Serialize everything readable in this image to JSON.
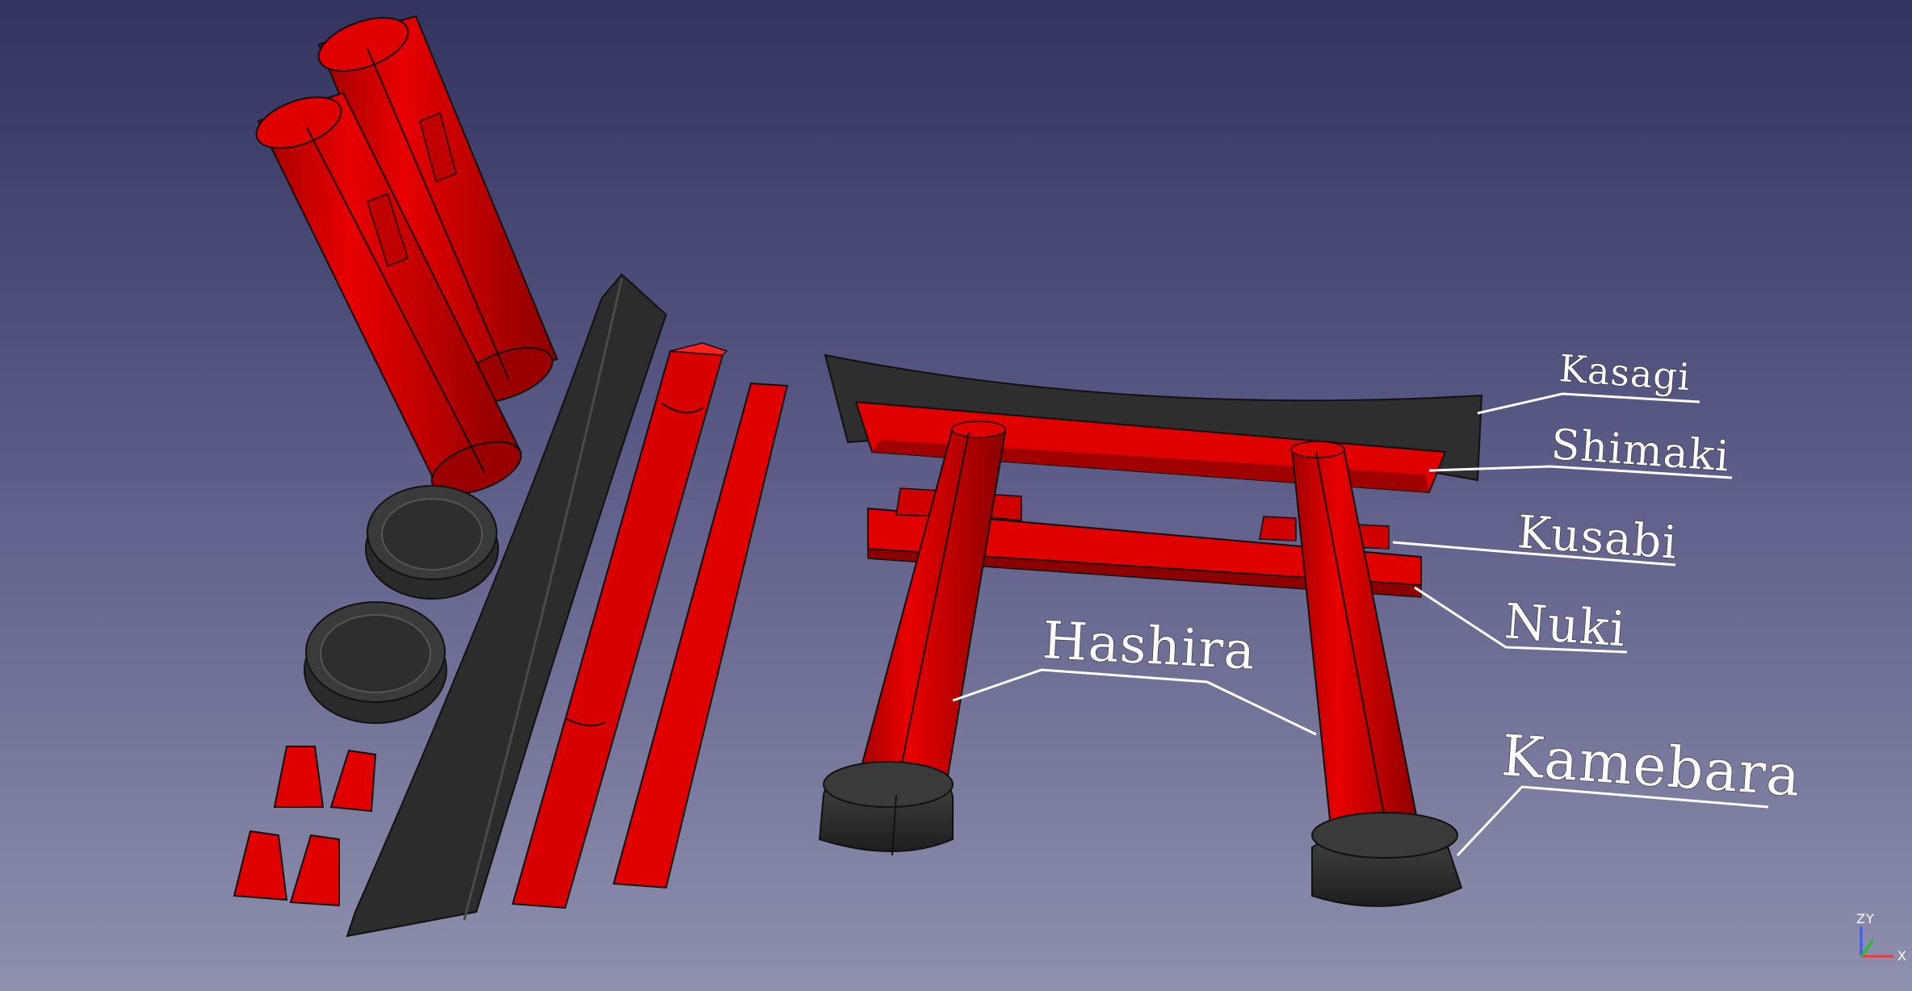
{
  "colors": {
    "part": "#e00000",
    "part_dark": "#8c0000",
    "cap": "#333333",
    "outline": "#111111",
    "leader": "#ffffff"
  },
  "labels": {
    "kasagi": "Kasagi",
    "shimaki": "Shimaki",
    "kusabi": "Kusabi",
    "nuki": "Nuki",
    "hashira": "Hashira",
    "kamebara": "Kamebara"
  },
  "axis": {
    "z": "Z",
    "y": "Y",
    "x": "X"
  }
}
